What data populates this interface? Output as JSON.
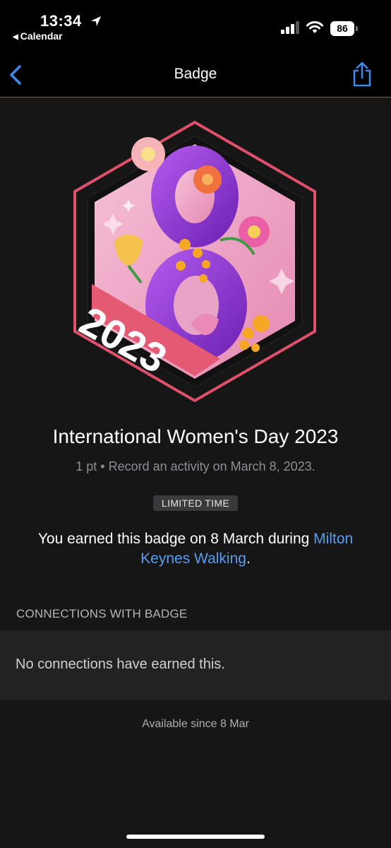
{
  "status_bar": {
    "time": "13:34",
    "back_app": "Calendar",
    "battery": "86"
  },
  "nav": {
    "title": "Badge"
  },
  "badge": {
    "art_year": "2023",
    "title": "International Women's Day 2023",
    "subtitle": "1 pt • Record an activity on March 8, 2023.",
    "tag": "LIMITED TIME",
    "earned_prefix": "You earned this badge on 8 March during ",
    "earned_link": "Milton Keynes Walking",
    "earned_suffix": "."
  },
  "connections": {
    "header": "CONNECTIONS WITH BADGE",
    "empty_text": "No connections have earned this."
  },
  "footer": {
    "available": "Available since 8 Mar"
  },
  "colors": {
    "accent": "#5a9cf2",
    "hex_border": "#e0506a",
    "purple": "#8a2fc9",
    "background": "#161616"
  }
}
